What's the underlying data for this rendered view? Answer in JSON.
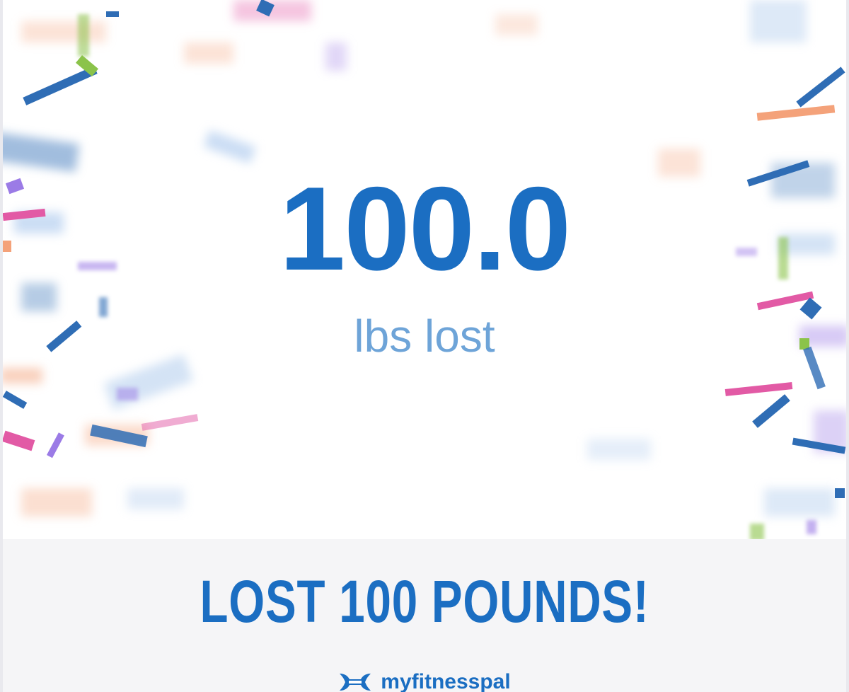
{
  "achievement": {
    "value": "100.0",
    "unit_label": "lbs lost",
    "headline": "LOST 100 POUNDS!"
  },
  "brand": {
    "logo_icon": "under-armour-logo-icon",
    "name": "myfitnesspal"
  },
  "colors": {
    "primary_blue": "#1b6ec2",
    "light_blue": "#6ea4d8",
    "footer_bg": "#f5f5f7",
    "confetti": [
      "#2f6db5",
      "#8bc34a",
      "#e25aa5",
      "#f4a27a",
      "#9b7be6",
      "#a9c7ec"
    ]
  },
  "decoration": "confetti-celebration"
}
